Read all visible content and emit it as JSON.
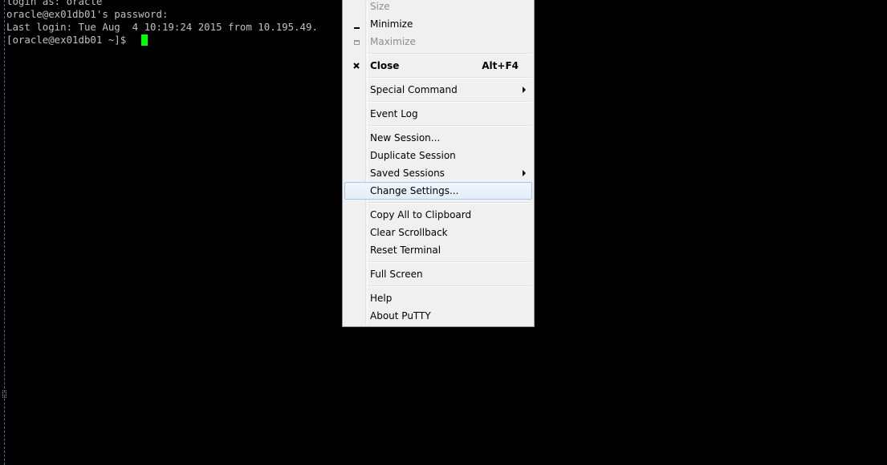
{
  "terminal": {
    "lines": [
      "login as: oracle",
      "oracle@ex01db01's password:",
      "Last login: Tue Aug  4 10:19:24 2015 from 10.195.49.",
      "[oracle@ex01db01 ~]$"
    ],
    "text_color": "#c0c0c0",
    "cursor_color": "#00ff00",
    "background": "#000000"
  },
  "menu": {
    "items": {
      "size": "Size",
      "minimize": "Minimize",
      "maximize": "Maximize",
      "close": "Close",
      "close_shortcut": "Alt+F4",
      "special_command": "Special Command",
      "event_log": "Event Log",
      "new_session": "New Session...",
      "duplicate_session": "Duplicate Session",
      "saved_sessions": "Saved Sessions",
      "change_settings": "Change Settings...",
      "copy_all": "Copy All to Clipboard",
      "clear_scrollback": "Clear Scrollback",
      "reset_terminal": "Reset Terminal",
      "full_screen": "Full Screen",
      "help": "Help",
      "about": "About PuTTY"
    },
    "highlighted": "change_settings"
  }
}
